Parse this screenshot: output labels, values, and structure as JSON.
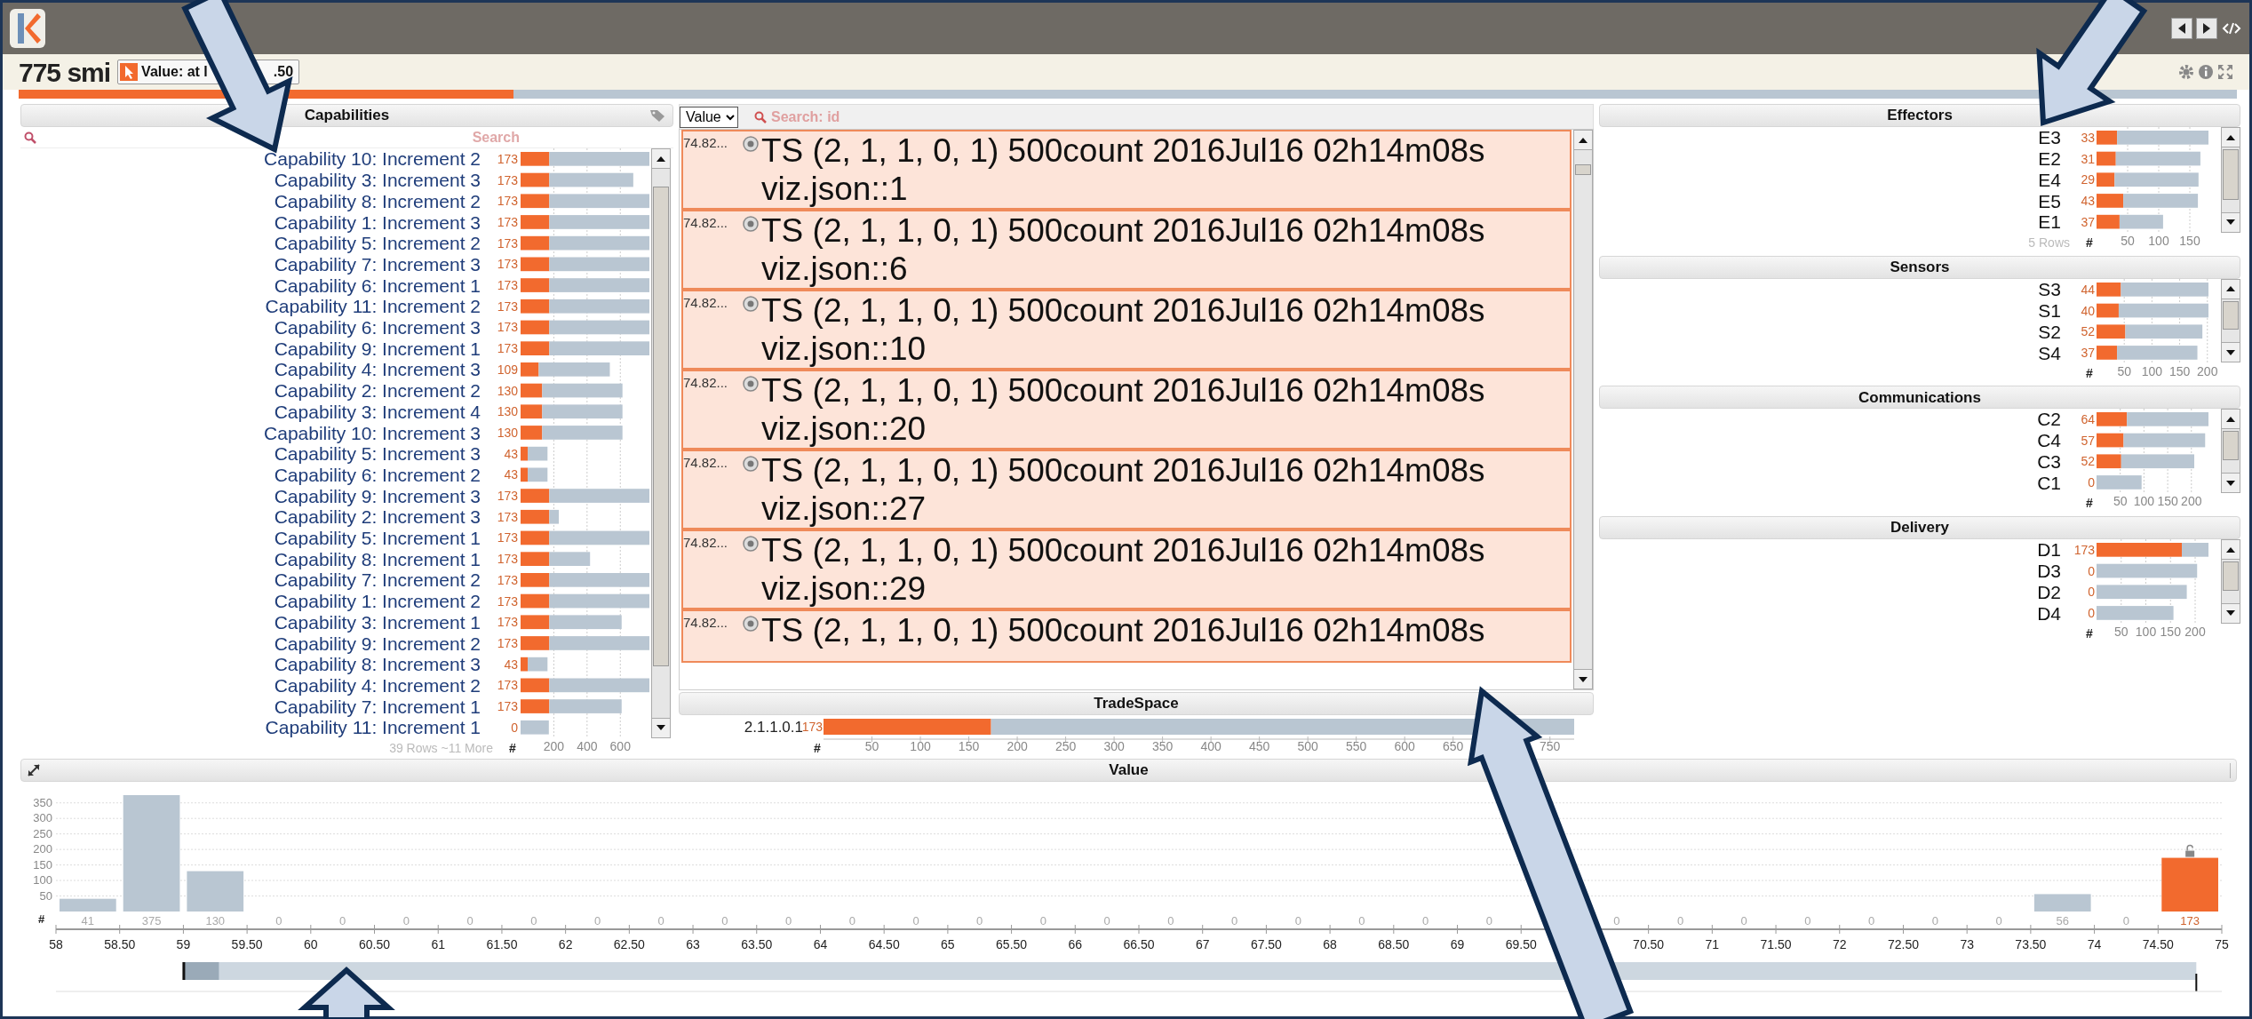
{
  "app": {
    "title": "775 smi",
    "value_filter": {
      "parts": [
        "Value: at l",
        ".50"
      ]
    },
    "progress": {
      "level": 0.223
    }
  },
  "capabilities": {
    "title": "Capabilities",
    "search": {
      "placeholder": "Search"
    },
    "footer": "39 Rows ~11 More",
    "axis_symbol": "#",
    "chart_data": {
      "type": "bar",
      "orientation": "horizontal",
      "stacked": true,
      "grid": true,
      "categories": [
        "Capability 10: Increment 2",
        "Capability 3: Increment 3",
        "Capability 8: Increment 2",
        "Capability 1: Increment 3",
        "Capability 5: Increment 2",
        "Capability 7: Increment 3",
        "Capability 6: Increment 1",
        "Capability 11: Increment 2",
        "Capability 6: Increment 3",
        "Capability 9: Increment 1",
        "Capability 4: Increment 3",
        "Capability 2: Increment 2",
        "Capability 3: Increment 4",
        "Capability 10: Increment 3",
        "Capability 5: Increment 3",
        "Capability 6: Increment 2",
        "Capability 9: Increment 3",
        "Capability 2: Increment 3",
        "Capability 5: Increment 1",
        "Capability 8: Increment 1",
        "Capability 7: Increment 2",
        "Capability 1: Increment 2",
        "Capability 3: Increment 1",
        "Capability 9: Increment 2",
        "Capability 8: Increment 3",
        "Capability 4: Increment 2",
        "Capability 7: Increment 1",
        "Capability 11: Increment 1"
      ],
      "series": [
        {
          "color": "#f26a2e",
          "values": [
            173,
            173,
            173,
            173,
            173,
            173,
            173,
            173,
            173,
            173,
            109,
            130,
            130,
            130,
            43,
            43,
            173,
            173,
            173,
            173,
            173,
            173,
            173,
            173,
            43,
            173,
            173,
            0
          ]
        },
        {
          "color": "#b9c6d2",
          "values": [
            602,
            505,
            602,
            602,
            602,
            602,
            602,
            602,
            602,
            602,
            428,
            483,
            483,
            483,
            119,
            119,
            602,
            57,
            602,
            245,
            602,
            602,
            435,
            602,
            119,
            602,
            435,
            170
          ]
        }
      ],
      "xlim": [
        0,
        775
      ],
      "xticks": [
        200,
        400,
        600
      ],
      "value_labels": [
        "173",
        "173",
        "173",
        "173",
        "173",
        "173",
        "173",
        "173",
        "173",
        "173",
        "109",
        "130",
        "130",
        "130",
        "43",
        "43",
        "173",
        "173",
        "173",
        "173",
        "173",
        "173",
        "173",
        "173",
        "43",
        "173",
        "173",
        "0"
      ]
    }
  },
  "records_panel": {
    "sort_select": {
      "value": "Value"
    },
    "search": {
      "placeholder": "Search: id"
    },
    "records": [
      {
        "value": "74.82...",
        "title": "TS (2, 1, 1, 0, 1) 500count 2016Jul16 02h14m08s",
        "subtitle": "viz.json::1"
      },
      {
        "value": "74.82...",
        "title": "TS (2, 1, 1, 0, 1) 500count 2016Jul16 02h14m08s",
        "subtitle": "viz.json::6"
      },
      {
        "value": "74.82...",
        "title": "TS (2, 1, 1, 0, 1) 500count 2016Jul16 02h14m08s",
        "subtitle": "viz.json::10"
      },
      {
        "value": "74.82...",
        "title": "TS (2, 1, 1, 0, 1) 500count 2016Jul16 02h14m08s",
        "subtitle": "viz.json::20"
      },
      {
        "value": "74.82...",
        "title": "TS (2, 1, 1, 0, 1) 500count 2016Jul16 02h14m08s",
        "subtitle": "viz.json::27"
      },
      {
        "value": "74.82...",
        "title": "TS (2, 1, 1, 0, 1) 500count 2016Jul16 02h14m08s",
        "subtitle": "viz.json::29"
      },
      {
        "value": "74.82...",
        "title": "TS (2, 1, 1, 0, 1) 500count 2016Jul16 02h14m08s"
      }
    ]
  },
  "tradespace": {
    "title": "TradeSpace",
    "axis_symbol": "#",
    "chart_data": {
      "type": "bar",
      "orientation": "horizontal",
      "stacked": true,
      "categories": [
        "2.1.1.0.1"
      ],
      "series": [
        {
          "color": "#f26a2e",
          "values": [
            173
          ]
        },
        {
          "color": "#b9c6d2",
          "values": [
            602
          ]
        }
      ],
      "xlim": [
        0,
        775
      ],
      "xticks": [
        50,
        100,
        150,
        200,
        250,
        300,
        350,
        400,
        450,
        500,
        550,
        600,
        650,
        750
      ],
      "value_labels": [
        "173"
      ]
    }
  },
  "dimension_panels": [
    {
      "title": "Effectors",
      "footer": "5 Rows",
      "axis_symbol": "#",
      "chart_data": {
        "type": "bar",
        "orientation": "horizontal",
        "stacked": true,
        "grid": true,
        "categories": [
          "E3",
          "E2",
          "E4",
          "E5",
          "E1"
        ],
        "series": [
          {
            "color": "#f26a2e",
            "values": [
              33,
              31,
              29,
              43,
              37
            ]
          },
          {
            "color": "#b9c6d2",
            "values": [
              147,
              136,
              135,
              120,
              70
            ]
          }
        ],
        "xlim": [
          0,
          180
        ],
        "xticks": [
          50,
          100,
          150
        ],
        "value_labels": [
          "33",
          "31",
          "29",
          "43",
          "37"
        ]
      }
    },
    {
      "title": "Sensors",
      "axis_symbol": "#",
      "chart_data": {
        "type": "bar",
        "orientation": "horizontal",
        "stacked": true,
        "grid": true,
        "categories": [
          "S3",
          "S1",
          "S2",
          "S4"
        ],
        "series": [
          {
            "color": "#f26a2e",
            "values": [
              44,
              40,
              52,
              37
            ]
          },
          {
            "color": "#b9c6d2",
            "values": [
              158,
              162,
              139,
              145
            ]
          }
        ],
        "xlim": [
          0,
          202
        ],
        "xticks": [
          50,
          100,
          150,
          200
        ],
        "value_labels": [
          "44",
          "40",
          "52",
          "37"
        ]
      }
    },
    {
      "title": "Communications",
      "axis_symbol": "#",
      "chart_data": {
        "type": "bar",
        "orientation": "horizontal",
        "stacked": true,
        "grid": true,
        "categories": [
          "C2",
          "C4",
          "C3",
          "C1"
        ],
        "series": [
          {
            "color": "#f26a2e",
            "values": [
              64,
              57,
              52,
              0
            ]
          },
          {
            "color": "#b9c6d2",
            "values": [
              172,
              172,
              154,
              95
            ]
          }
        ],
        "xlim": [
          0,
          236
        ],
        "xticks": [
          50,
          100,
          150,
          200
        ],
        "value_labels": [
          "64",
          "57",
          "52",
          "0"
        ]
      }
    },
    {
      "title": "Delivery",
      "axis_symbol": "#",
      "chart_data": {
        "type": "bar",
        "orientation": "horizontal",
        "stacked": true,
        "grid": true,
        "categories": [
          "D1",
          "D3",
          "D2",
          "D4"
        ],
        "series": [
          {
            "color": "#f26a2e",
            "values": [
              173,
              0,
              0,
              0
            ]
          },
          {
            "color": "#b9c6d2",
            "values": [
              54,
              204,
              183,
              156
            ]
          }
        ],
        "xlim": [
          0,
          227
        ],
        "xticks": [
          50,
          100,
          150,
          200
        ],
        "value_labels": [
          "173",
          "0",
          "0",
          "0"
        ]
      }
    }
  ],
  "value_panel": {
    "title": "Value",
    "axis_symbol": "#",
    "chart_data": {
      "type": "bar",
      "grid": true,
      "x": [
        58,
        58.5,
        59,
        59.5,
        60,
        60.5,
        61,
        61.5,
        62,
        62.5,
        63,
        63.5,
        64,
        64.5,
        65,
        65.5,
        66,
        66.5,
        67,
        67.5,
        68,
        68.5,
        69,
        69.5,
        70,
        70.5,
        71,
        71.5,
        72,
        72.5,
        73,
        73.5,
        74,
        74.5
      ],
      "series": [
        {
          "color": "#f26a2e",
          "values": [
            0,
            0,
            0,
            0,
            0,
            0,
            0,
            0,
            0,
            0,
            0,
            0,
            0,
            0,
            0,
            0,
            0,
            0,
            0,
            0,
            0,
            0,
            0,
            0,
            0,
            0,
            0,
            0,
            0,
            0,
            0,
            0,
            0,
            173
          ]
        },
        {
          "color": "#b9c6d2",
          "values": [
            41,
            375,
            130,
            0,
            0,
            0,
            0,
            0,
            0,
            0,
            0,
            0,
            0,
            0,
            0,
            0,
            0,
            0,
            0,
            0,
            0,
            0,
            0,
            0,
            0,
            0,
            0,
            0,
            0,
            0,
            0,
            56,
            0,
            0
          ]
        }
      ],
      "xlim": [
        58,
        75
      ],
      "ylim": [
        0,
        375
      ],
      "yticks": [
        50,
        100,
        150,
        200,
        250,
        300,
        350
      ],
      "xticks": [
        58,
        {
          "value": 58.5,
          "label": "58.50"
        },
        59,
        {
          "value": 59.5,
          "label": "59.50"
        },
        60,
        {
          "value": 60.5,
          "label": "60.50"
        },
        61,
        {
          "value": 61.5,
          "label": "61.50"
        },
        62,
        {
          "value": 62.5,
          "label": "62.50"
        },
        63,
        {
          "value": 63.5,
          "label": "63.50"
        },
        64,
        {
          "value": 64.5,
          "label": "64.50"
        },
        65,
        {
          "value": 65.5,
          "label": "65.50"
        },
        66,
        {
          "value": 66.5,
          "label": "66.50"
        },
        67,
        {
          "value": 67.5,
          "label": "67.50"
        },
        68,
        {
          "value": 68.5,
          "label": "68.50"
        },
        69,
        {
          "value": 69.5,
          "label": "69.50"
        },
        {
          "value": 70.5,
          "label": "70.50"
        },
        71,
        {
          "value": 71.5,
          "label": "71.50"
        },
        72,
        {
          "value": 72.5,
          "label": "72.50"
        },
        73,
        {
          "value": 73.5,
          "label": "73.50"
        },
        74,
        {
          "value": 74.5,
          "label": "74.50"
        },
        75
      ],
      "value_labels": [
        "41",
        "375",
        "130",
        "0",
        "0",
        "0",
        "0",
        "0",
        "0",
        "0",
        "0",
        "0",
        "0",
        "0",
        "0",
        "0",
        "0",
        "0",
        "0",
        "0",
        "0",
        "0",
        "0",
        null,
        "0",
        "0",
        "0",
        "0",
        "0",
        "0",
        "0",
        "56",
        "0",
        "173"
      ]
    }
  }
}
